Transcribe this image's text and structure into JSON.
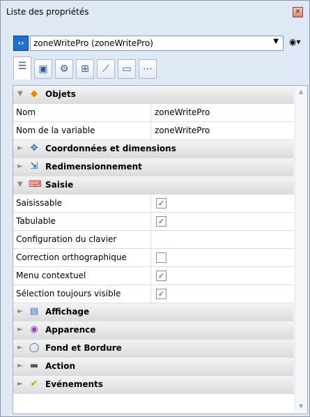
{
  "window": {
    "title": "Liste des propriétés",
    "close_glyph": "×"
  },
  "object_selector": {
    "selected": "zoneWritePro (zoneWritePro)"
  },
  "toolbar_icons": [
    "list-icon",
    "form-icon",
    "gear-icon",
    "objects-icon",
    "graph-icon",
    "monitor-icon",
    "more-icon"
  ],
  "sections": {
    "objets": {
      "label": "Objets",
      "icon": "cube-icon"
    },
    "coord": {
      "label": "Coordonnées et dimensions",
      "icon": "move-icon"
    },
    "redim": {
      "label": "Redimensionnement",
      "icon": "resize-icon"
    },
    "saisie": {
      "label": "Saisie",
      "icon": "keyboard-icon"
    },
    "affichage": {
      "label": "Affichage",
      "icon": "display-icon"
    },
    "apparence": {
      "label": "Apparence",
      "icon": "eye-icon"
    },
    "fond": {
      "label": "Fond et Bordure",
      "icon": "shape-icon"
    },
    "action": {
      "label": "Action",
      "icon": "action-icon"
    },
    "evenements": {
      "label": "Evénements",
      "icon": "events-icon"
    }
  },
  "props": {
    "nom": {
      "label": "Nom",
      "value": "zoneWritePro"
    },
    "nom_var": {
      "label": "Nom de la variable",
      "value": "zoneWritePro"
    },
    "saisissable": {
      "label": "Saisissable",
      "checked": true
    },
    "tabulable": {
      "label": "Tabulable",
      "checked": true
    },
    "config_clavier": {
      "label": "Configuration du clavier",
      "value": ""
    },
    "correction": {
      "label": "Correction orthographique",
      "checked": false
    },
    "menu": {
      "label": "Menu contextuel",
      "checked": true
    },
    "selection": {
      "label": "Sélection toujours visible",
      "checked": true
    }
  },
  "glyphs": {
    "expanded": "▼",
    "collapsed": "►",
    "check": "✓"
  }
}
